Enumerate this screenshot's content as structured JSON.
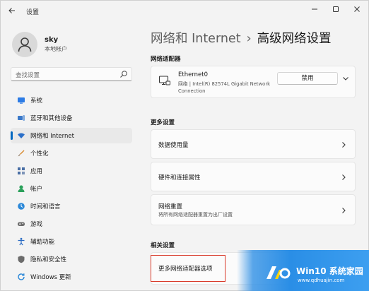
{
  "window": {
    "title": "设置",
    "controls": [
      "minimize",
      "maximize",
      "close"
    ]
  },
  "profile": {
    "name": "sky",
    "account_type": "本地帐户"
  },
  "search": {
    "placeholder": "查找设置"
  },
  "nav": {
    "items": [
      {
        "label": "系统",
        "icon": "system-icon",
        "color": "#2c7be5"
      },
      {
        "label": "蓝牙和其他设备",
        "icon": "bluetooth-devices-icon",
        "color": "#3a78c9"
      },
      {
        "label": "网络和 Internet",
        "icon": "wifi-icon",
        "color": "#2a6fc9",
        "active": true
      },
      {
        "label": "个性化",
        "icon": "brush-icon",
        "color": "#d8892e"
      },
      {
        "label": "应用",
        "icon": "apps-icon",
        "color": "#4a6fa5"
      },
      {
        "label": "帐户",
        "icon": "account-icon",
        "color": "#2aa05a"
      },
      {
        "label": "时间和语言",
        "icon": "globe-clock-icon",
        "color": "#2b88d8"
      },
      {
        "label": "游戏",
        "icon": "gamepad-icon",
        "color": "#6b6b6b"
      },
      {
        "label": "辅助功能",
        "icon": "accessibility-icon",
        "color": "#2b6cc4"
      },
      {
        "label": "隐私和安全性",
        "icon": "shield-icon",
        "color": "#6b6b6b"
      },
      {
        "label": "Windows 更新",
        "icon": "update-icon",
        "color": "#2b88d8"
      }
    ]
  },
  "breadcrumb": {
    "parent": "网络和 Internet",
    "separator": "›",
    "current": "高级网络设置"
  },
  "adapters_section": {
    "heading": "网络适配器",
    "adapter": {
      "name": "Ethernet0",
      "description": "网络 | Intel(R) 82574L Gigabit Network Connection",
      "button_label": "禁用"
    }
  },
  "more_settings": {
    "heading": "更多设置",
    "rows": [
      {
        "label": "数据使用量",
        "subtitle": ""
      },
      {
        "label": "硬件和连接属性",
        "subtitle": ""
      },
      {
        "label": "网络重置",
        "subtitle": "将所有网络适配器重置为出厂设置"
      }
    ]
  },
  "related_settings": {
    "heading": "相关设置",
    "rows": [
      {
        "label": "更多网络适配器选项"
      }
    ]
  },
  "watermark": {
    "brand": "Win10 系统家园",
    "url": "www.qdhuajin.com"
  },
  "colors": {
    "accent": "#0067c0",
    "highlight_border": "#d93b2b"
  }
}
